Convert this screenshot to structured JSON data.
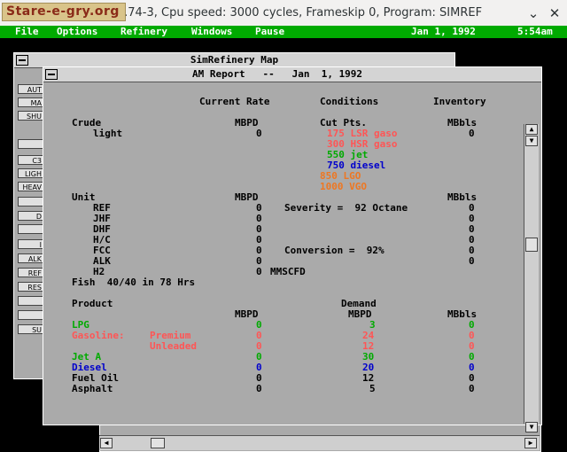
{
  "host": {
    "title": "x 0.74-3, Cpu speed: 3000 cycles, Frameskip 0, Program: SIMREF",
    "logo_text": "Stare-e-gry.org",
    "minimize_glyph": "⌄",
    "close_glyph": "✕"
  },
  "menu": {
    "items": [
      "File",
      "Options",
      "Refinery",
      "Windows",
      "Pause"
    ],
    "date": "Jan  1, 1992",
    "time": "5:54am"
  },
  "map_window": {
    "title": "SimRefinery Map",
    "buttons": [
      "AUT",
      "MA",
      "SHU",
      "",
      "C3",
      "LIGH",
      "HEAV",
      "",
      "D",
      "",
      "I",
      "ALK",
      "REF",
      "RES",
      "",
      "",
      "SU"
    ]
  },
  "report": {
    "title": "AM Report   --   Jan  1, 1992",
    "headers": {
      "current_rate": "Current Rate",
      "conditions": "Conditions",
      "inventory": "Inventory"
    },
    "crude": {
      "label": "Crude",
      "unit": "MBPD",
      "name": "light",
      "value": "0",
      "cut_label": "Cut Pts.",
      "inv_unit": "MBbls",
      "inv_value": "0",
      "cuts": [
        {
          "text": "175 LSR gaso",
          "color": "#ff5555"
        },
        {
          "text": "300 HSR gaso",
          "color": "#ff5555"
        },
        {
          "text": "550 jet",
          "color": "#00aa00"
        },
        {
          "text": "750 diesel",
          "color": "#0000cc"
        },
        {
          "text": "850 LGO",
          "color": "#ee7722"
        },
        {
          "text": "1000 VGO",
          "color": "#ee7722"
        }
      ]
    },
    "units": {
      "label": "Unit",
      "unit": "MBPD",
      "inv_unit": "MBbls",
      "rows": [
        {
          "name": "REF",
          "value": "0",
          "inv": "0"
        },
        {
          "name": "JHF",
          "value": "0",
          "inv": "0"
        },
        {
          "name": "DHF",
          "value": "0",
          "inv": "0"
        },
        {
          "name": "H/C",
          "value": "0",
          "inv": "0"
        },
        {
          "name": "FCC",
          "value": "0",
          "inv": "0"
        },
        {
          "name": "ALK",
          "value": "0",
          "inv": "0"
        },
        {
          "name": "H2",
          "value": "0",
          "inv": ""
        }
      ],
      "severity": "Severity =  92 Octane",
      "conversion": "Conversion =  92%",
      "h2_unit": "MMSCFD"
    },
    "fish": "Fish  40/40 in 78 Hrs",
    "products": {
      "label": "Product",
      "demand_label": "Demand",
      "rate_unit": "MBPD",
      "demand_unit": "MBPD",
      "inv_unit": "MBbls",
      "rows": [
        {
          "name": "LPG",
          "sub": "",
          "rate": "0",
          "demand": "3",
          "inv": "0",
          "color": "#00aa00"
        },
        {
          "name": "Gasoline:",
          "sub": "Premium",
          "rate": "0",
          "demand": "24",
          "inv": "0",
          "color": "#ff5555"
        },
        {
          "name": "",
          "sub": "Unleaded",
          "rate": "0",
          "demand": "12",
          "inv": "0",
          "color": "#ff5555"
        },
        {
          "name": "Jet A",
          "sub": "",
          "rate": "0",
          "demand": "30",
          "inv": "0",
          "color": "#00aa00"
        },
        {
          "name": "Diesel",
          "sub": "",
          "rate": "0",
          "demand": "20",
          "inv": "0",
          "color": "#0000cc"
        },
        {
          "name": "Fuel Oil",
          "sub": "",
          "rate": "0",
          "demand": "12",
          "inv": "0",
          "color": "#000000"
        },
        {
          "name": "Asphalt",
          "sub": "",
          "rate": "0",
          "demand": "5",
          "inv": "0",
          "color": "#000000"
        }
      ]
    }
  }
}
